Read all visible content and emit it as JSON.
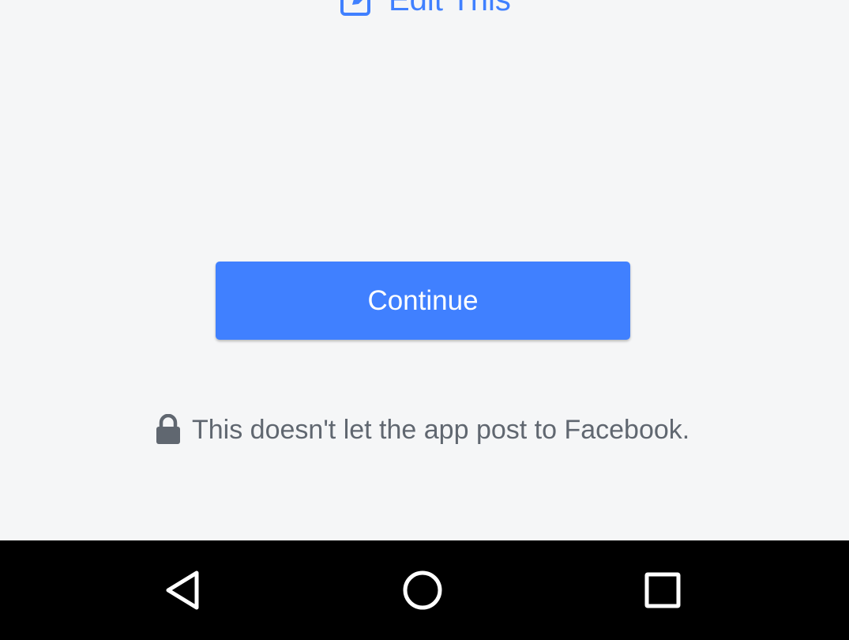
{
  "edit": {
    "label": "Edit This",
    "icon": "edit-icon"
  },
  "continue_button": {
    "label": "Continue"
  },
  "notice": {
    "icon": "lock-icon",
    "text": "This doesn't let the app post to Facebook."
  },
  "nav": {
    "back_icon": "back-triangle-icon",
    "home_icon": "home-circle-icon",
    "recents_icon": "recents-square-icon"
  },
  "colors": {
    "accent": "#4080ff",
    "background": "#f5f6f7",
    "notice_text": "#606770",
    "navbar": "#000000"
  }
}
